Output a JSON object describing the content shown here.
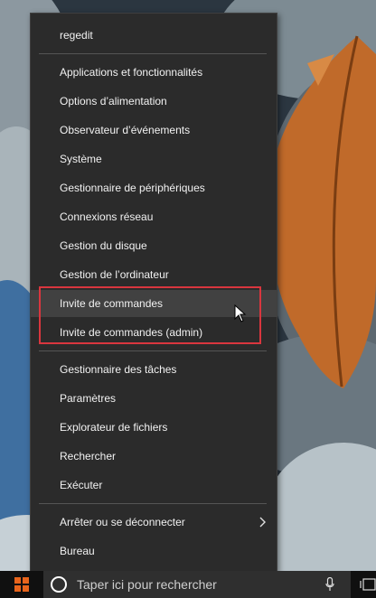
{
  "menu": {
    "items": [
      {
        "label": "regedit"
      },
      {
        "label": "Applications et fonctionnalités"
      },
      {
        "label": "Options d’alimentation"
      },
      {
        "label": "Observateur d’événements"
      },
      {
        "label": "Système"
      },
      {
        "label": "Gestionnaire de périphériques"
      },
      {
        "label": "Connexions réseau"
      },
      {
        "label": "Gestion du disque"
      },
      {
        "label": "Gestion de l’ordinateur"
      },
      {
        "label": "Invite de commandes"
      },
      {
        "label": "Invite de commandes (admin)"
      },
      {
        "label": "Gestionnaire des tâches"
      },
      {
        "label": "Paramètres"
      },
      {
        "label": "Explorateur de fichiers"
      },
      {
        "label": "Rechercher"
      },
      {
        "label": "Exécuter"
      },
      {
        "label": "Arrêter ou se déconnecter"
      },
      {
        "label": "Bureau"
      }
    ],
    "hovered_item": "Invite de commandes",
    "highlight_color": "#d9363e"
  },
  "taskbar": {
    "search_placeholder": "Taper ici pour rechercher",
    "start_icon": "windows-logo-icon",
    "mic_icon": "microphone-icon",
    "task_view_icon": "task-view-icon",
    "accent": "#e8641c"
  }
}
